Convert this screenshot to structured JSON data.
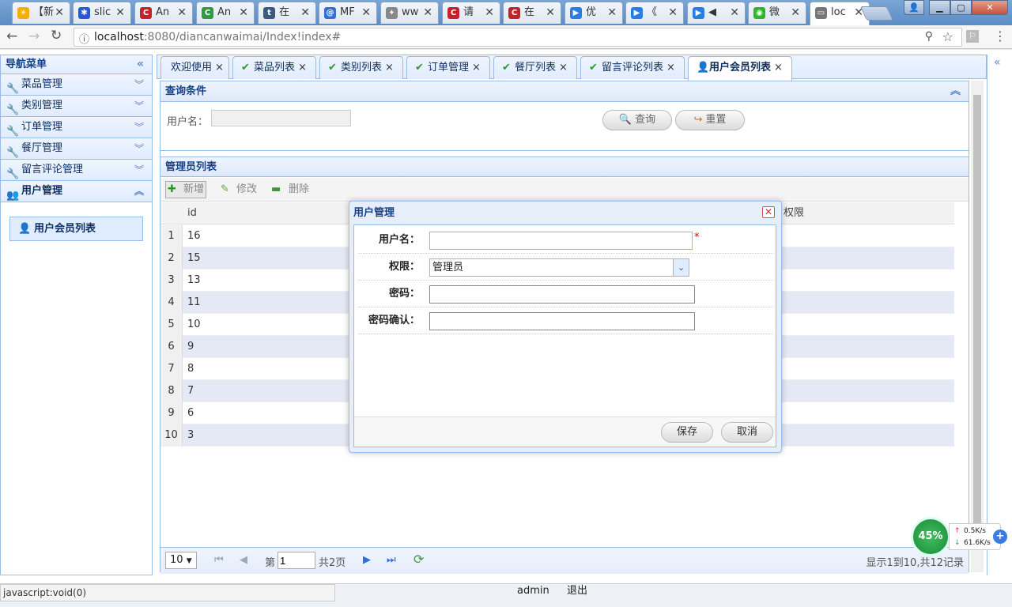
{
  "browser": {
    "tabs": [
      {
        "label": "【新",
        "icon": "sun-icon",
        "color": "#f0b000"
      },
      {
        "label": "slic",
        "icon": "paw-icon",
        "color": "#2a57d8"
      },
      {
        "label": "An",
        "icon": "c-icon",
        "color": "#c8202a"
      },
      {
        "label": "An",
        "icon": "c-circle-icon",
        "color": "#2e9a44"
      },
      {
        "label": "在",
        "icon": "t-icon",
        "color": "#3b5a80"
      },
      {
        "label": "MF",
        "icon": "at-icon",
        "color": "#2f6fd6"
      },
      {
        "label": "ww",
        "icon": "puzzle-icon",
        "color": "#888888"
      },
      {
        "label": "请",
        "icon": "c-icon",
        "color": "#c8202a"
      },
      {
        "label": "在",
        "icon": "c-icon",
        "color": "#c8202a"
      },
      {
        "label": "优",
        "icon": "play-icon",
        "color": "#2a7de1"
      },
      {
        "label": "《",
        "icon": "play-icon",
        "color": "#2a7de1"
      },
      {
        "label": "◀",
        "icon": "play-icon",
        "color": "#2a7de1"
      },
      {
        "label": "微",
        "icon": "chat-icon",
        "color": "#2db52d"
      },
      {
        "label": "loc",
        "icon": "page-icon",
        "color": "#777777"
      }
    ],
    "url_host": "localhost",
    "url_rest": ":8080/diancanwaimai/Index!index#",
    "status_text": "javascript:void(0)"
  },
  "west": {
    "title": "导航菜单",
    "sections": [
      "菜品管理",
      "类别管理",
      "订单管理",
      "餐厅管理",
      "留言评论管理",
      "用户管理"
    ],
    "sub_item": "用户会员列表"
  },
  "tabs": [
    "欢迎使用",
    "菜品列表",
    "类别列表",
    "订单管理",
    "餐厅列表",
    "留言评论列表",
    "用户会员列表"
  ],
  "query": {
    "title": "查询条件",
    "username_label": "用户名：",
    "search_btn": "查询",
    "reset_btn": "重置"
  },
  "list": {
    "title": "管理员列表",
    "add": "新增",
    "edit": "修改",
    "delete": "删除",
    "col_id": "id",
    "col_perm": "权限",
    "rows": [
      {
        "n": "1",
        "id": "16"
      },
      {
        "n": "2",
        "id": "15"
      },
      {
        "n": "3",
        "id": "13"
      },
      {
        "n": "4",
        "id": "11"
      },
      {
        "n": "5",
        "id": "10"
      },
      {
        "n": "6",
        "id": "9"
      },
      {
        "n": "7",
        "id": "8"
      },
      {
        "n": "8",
        "id": "7"
      },
      {
        "n": "9",
        "id": "6"
      },
      {
        "n": "10",
        "id": "3"
      }
    ]
  },
  "pager": {
    "page_size": "10",
    "page_prefix": "第",
    "page_value": "1",
    "page_total": "共2页",
    "summary": "显示1到10,共12记录"
  },
  "dialog": {
    "title": "用户管理",
    "username_label": "用户名：",
    "perm_label": "权限：",
    "perm_value": "管理员",
    "pwd_label": "密码：",
    "pwd_confirm_label": "密码确认：",
    "required_mark": "*",
    "save": "保存",
    "cancel": "取消"
  },
  "footer": {
    "user": "admin",
    "logout": "退出"
  },
  "netmon": {
    "percent": "45%",
    "up": "0.5K/s",
    "down": "61.6K/s"
  }
}
